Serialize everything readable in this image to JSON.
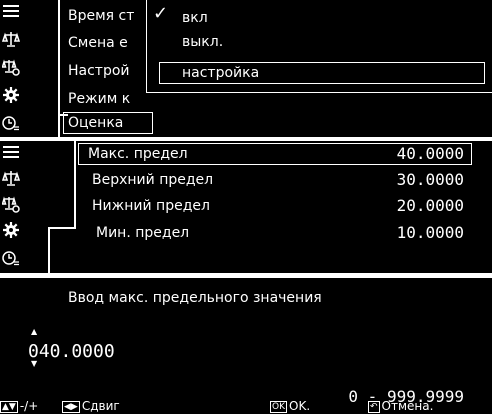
{
  "menu": {
    "items": [
      "Время ст",
      "Смена е",
      "Настрой",
      "Режим к",
      "Оценка"
    ],
    "dropdown": {
      "on": "вкл",
      "off": "выкл.",
      "setting": "настройка",
      "check": "✓"
    }
  },
  "limits": {
    "rows": [
      {
        "label": "Макс. предел",
        "value": "40.0000"
      },
      {
        "label": "Верхний предел",
        "value": "30.0000"
      },
      {
        "label": "Нижний предел",
        "value": "20.0000"
      },
      {
        "label": "Мин. предел",
        "value": "10.0000"
      }
    ]
  },
  "input": {
    "title": "Ввод макс. предельного значения",
    "value": "040.0000",
    "range": "0 - 999.9999",
    "footer": {
      "inc_label": "-/+",
      "shift_label": "Сдвиг",
      "ok_key": "OK",
      "ok_label": "OK.",
      "cancel_label": "Отмена."
    }
  },
  "icons": [
    "list-icon",
    "balance-icon",
    "balance-settings-icon",
    "gear-icon",
    "clock-settings-icon"
  ]
}
